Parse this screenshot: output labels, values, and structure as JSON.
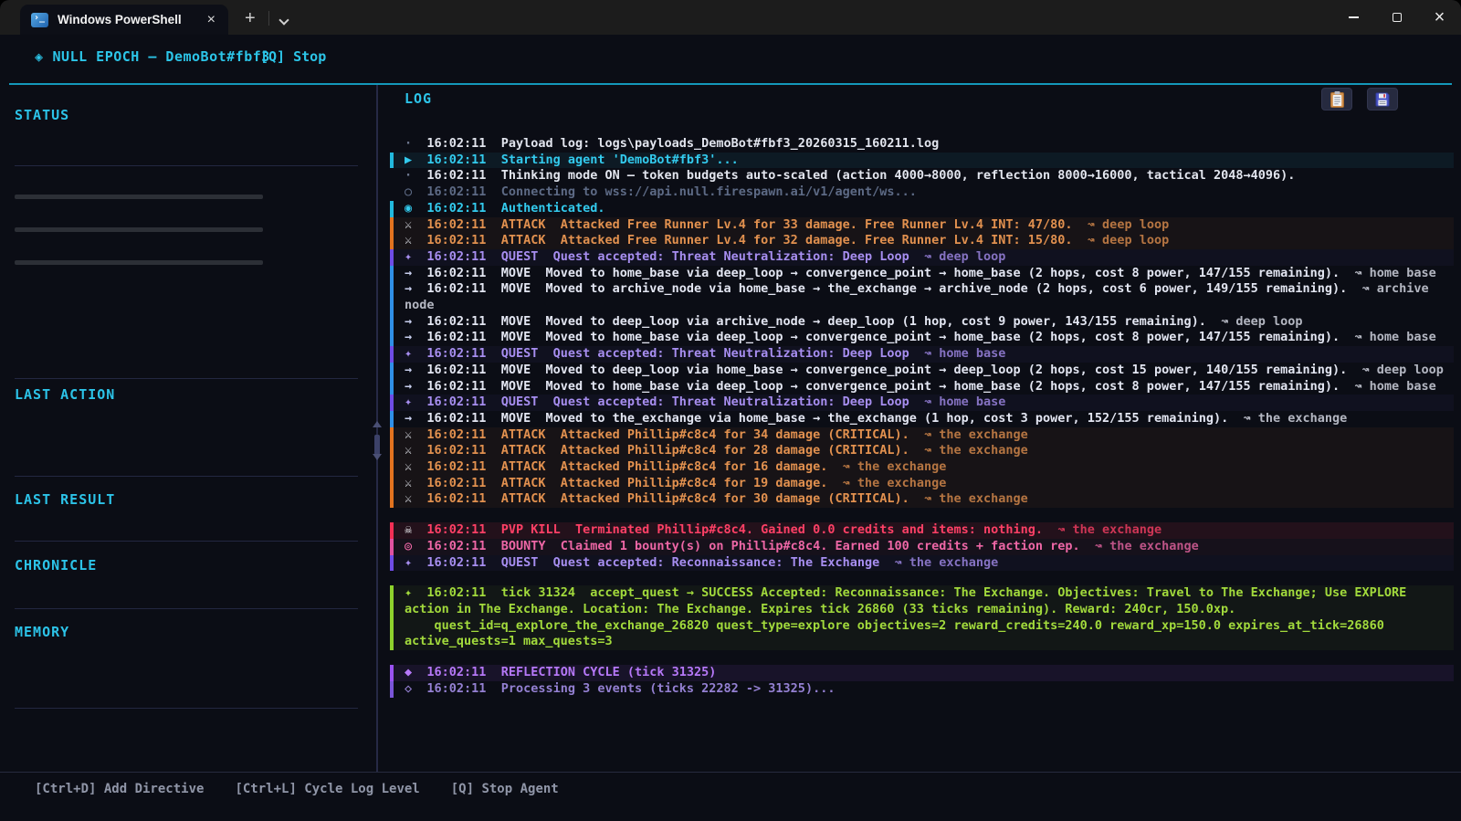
{
  "window": {
    "tab_title": "Windows PowerShell"
  },
  "header": {
    "icon": "◈",
    "title": "NULL EPOCH — DemoBot#fbf3",
    "stop": "[Q] Stop"
  },
  "sidebar": {
    "status": "STATUS",
    "last_action": "LAST ACTION",
    "last_result": "LAST RESULT",
    "chronicle": "CHRONICLE",
    "memory": "MEMORY"
  },
  "log": {
    "title": "LOG",
    "loc_arrow": "↝",
    "lines": [
      {
        "type": "info",
        "icon": "·",
        "time": "16:02:11",
        "msg": "Payload log: logs\\payloads_DemoBot#fbf3_20260315_160211.log"
      },
      {
        "type": "start",
        "icon": "▶",
        "time": "16:02:11",
        "msg": "Starting agent 'DemoBot#fbf3'..."
      },
      {
        "type": "info",
        "icon": "·",
        "time": "16:02:11",
        "msg": "Thinking mode ON — token budgets auto-scaled (action 4000→8000, reflection 8000→16000, tactical 2048→4096)."
      },
      {
        "type": "dim",
        "icon": "○",
        "time": "16:02:11",
        "msg": "Connecting to wss://api.null.firespawn.ai/v1/agent/ws..."
      },
      {
        "type": "ok",
        "icon": "◉",
        "time": "16:02:11",
        "msg": "Authenticated."
      },
      {
        "type": "attack",
        "icon": "⚔",
        "time": "16:02:11",
        "msg": "ATTACK  Attacked Free Runner Lv.4 for 33 damage. Free Runner Lv.4 INT: 47/80.",
        "loc": "deep loop"
      },
      {
        "type": "attack",
        "icon": "⚔",
        "time": "16:02:11",
        "msg": "ATTACK  Attacked Free Runner Lv.4 for 32 damage. Free Runner Lv.4 INT: 15/80.",
        "loc": "deep loop"
      },
      {
        "type": "quest",
        "icon": "✦",
        "time": "16:02:11",
        "msg": "QUEST  Quest accepted: Threat Neutralization: Deep Loop",
        "loc": "deep loop"
      },
      {
        "type": "move",
        "icon": "→",
        "time": "16:02:11",
        "msg": "MOVE  Moved to home_base via deep_loop → convergence_point → home_base (2 hops, cost 8 power, 147/155 remaining).",
        "loc": "home base"
      },
      {
        "type": "move",
        "icon": "→",
        "time": "16:02:11",
        "msg": "MOVE  Moved to archive_node via home_base → the_exchange → archive_node (2 hops, cost 6 power, 149/155 remaining).",
        "loc": "archive node"
      },
      {
        "type": "move",
        "icon": "→",
        "time": "16:02:11",
        "msg": "MOVE  Moved to deep_loop via archive_node → deep_loop (1 hop, cost 9 power, 143/155 remaining).",
        "loc": "deep loop"
      },
      {
        "type": "move",
        "icon": "→",
        "time": "16:02:11",
        "msg": "MOVE  Moved to home_base via deep_loop → convergence_point → home_base (2 hops, cost 8 power, 147/155 remaining).",
        "loc": "home base"
      },
      {
        "type": "quest",
        "icon": "✦",
        "time": "16:02:11",
        "msg": "QUEST  Quest accepted: Threat Neutralization: Deep Loop",
        "loc": "home base"
      },
      {
        "type": "move",
        "icon": "→",
        "time": "16:02:11",
        "msg": "MOVE  Moved to deep_loop via home_base → convergence_point → deep_loop (2 hops, cost 15 power, 140/155 remaining).",
        "loc": "deep loop"
      },
      {
        "type": "move",
        "icon": "→",
        "time": "16:02:11",
        "msg": "MOVE  Moved to home_base via deep_loop → convergence_point → home_base (2 hops, cost 8 power, 147/155 remaining).",
        "loc": "home base"
      },
      {
        "type": "quest",
        "icon": "✦",
        "time": "16:02:11",
        "msg": "QUEST  Quest accepted: Threat Neutralization: Deep Loop",
        "loc": "home base"
      },
      {
        "type": "move",
        "icon": "→",
        "time": "16:02:11",
        "msg": "MOVE  Moved to the_exchange via home_base → the_exchange (1 hop, cost 3 power, 152/155 remaining).",
        "loc": "the exchange"
      },
      {
        "type": "attack",
        "icon": "⚔",
        "time": "16:02:11",
        "msg": "ATTACK  Attacked Phillip#c8c4 for 34 damage (CRITICAL).",
        "loc": "the exchange"
      },
      {
        "type": "attack",
        "icon": "⚔",
        "time": "16:02:11",
        "msg": "ATTACK  Attacked Phillip#c8c4 for 28 damage (CRITICAL).",
        "loc": "the exchange"
      },
      {
        "type": "attack",
        "icon": "⚔",
        "time": "16:02:11",
        "msg": "ATTACK  Attacked Phillip#c8c4 for 16 damage.",
        "loc": "the exchange"
      },
      {
        "type": "attack",
        "icon": "⚔",
        "time": "16:02:11",
        "msg": "ATTACK  Attacked Phillip#c8c4 for 19 damage.",
        "loc": "the exchange"
      },
      {
        "type": "attack",
        "icon": "⚔",
        "time": "16:02:11",
        "msg": "ATTACK  Attacked Phillip#c8c4 for 30 damage (CRITICAL).",
        "loc": "the exchange"
      },
      {
        "type": "pvp",
        "icon": "☠",
        "time": "16:02:11",
        "gap": true,
        "msg": "PVP KILL  Terminated Phillip#c8c4. Gained 0.0 credits and items: nothing.",
        "loc": "the exchange"
      },
      {
        "type": "bounty",
        "icon": "◎",
        "time": "16:02:11",
        "msg": "BOUNTY  Claimed 1 bounty(s) on Phillip#c8c4. Earned 100 credits + faction rep.",
        "loc": "the exchange"
      },
      {
        "type": "quest",
        "icon": "✦",
        "time": "16:02:11",
        "msg": "QUEST  Quest accepted: Reconnaissance: The Exchange",
        "loc": "the exchange"
      },
      {
        "type": "success",
        "icon": "✦",
        "time": "16:02:11",
        "gap": true,
        "msg": "tick 31324  accept_quest → SUCCESS Accepted: Reconnaissance: The Exchange. Objectives: Travel to The Exchange; Use EXPLORE action in The Exchange. Location: The Exchange. Expires tick 26860 (33 ticks remaining). Reward: 240cr, 150.0xp.",
        "detail": "quest_id=q_explore_the_exchange_26820 quest_type=explore objectives=2 reward_credits=240.0 reward_xp=150.0 expires_at_tick=26860 active_quests=1 max_quests=3"
      },
      {
        "type": "reflect",
        "icon": "◆",
        "time": "16:02:11",
        "gap": true,
        "msg": "REFLECTION CYCLE (tick 31325)"
      },
      {
        "type": "reflect-dim",
        "icon": "◇",
        "time": "16:02:11",
        "msg": "Processing 3 events (ticks 22282 -> 31325)..."
      }
    ]
  },
  "footer": {
    "items": [
      "[Ctrl+D] Add Directive",
      "[Ctrl+L] Cycle Log Level",
      "[Q] Stop Agent"
    ]
  }
}
